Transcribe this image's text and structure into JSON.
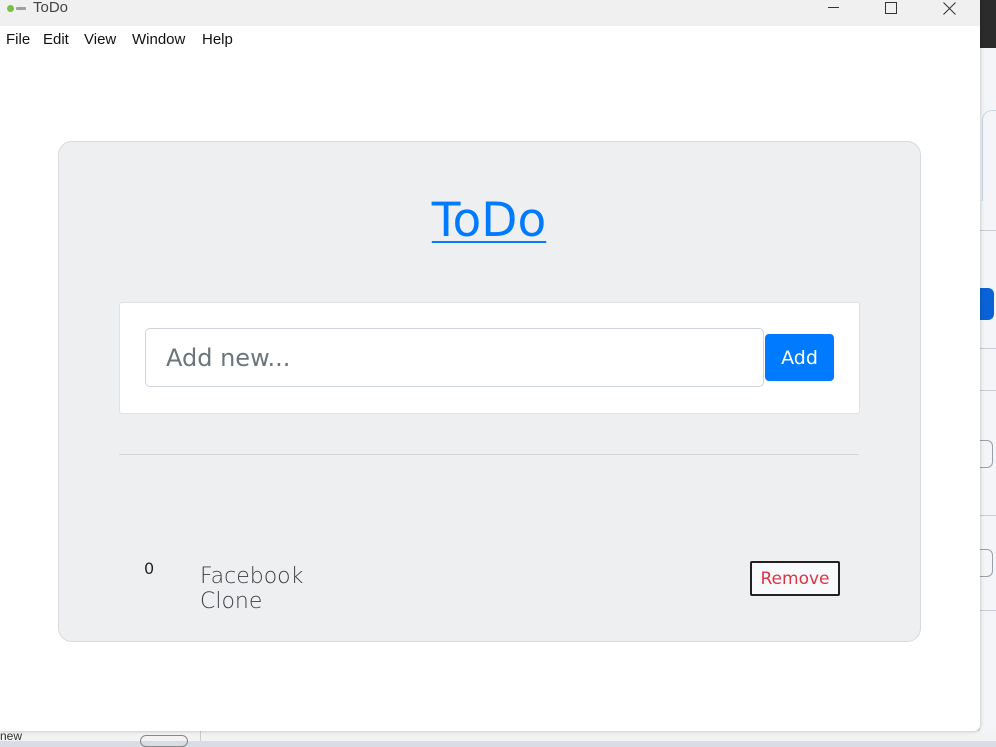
{
  "window": {
    "title": "ToDo",
    "icon": "app-logo-icon",
    "controls": {
      "minimize": "minimize-icon",
      "maximize": "maximize-icon",
      "close": "close-icon"
    }
  },
  "menu": {
    "items": [
      {
        "label": "File"
      },
      {
        "label": "Edit"
      },
      {
        "label": "View"
      },
      {
        "label": "Window"
      },
      {
        "label": "Help"
      }
    ]
  },
  "app": {
    "heading": "ToDo",
    "input": {
      "placeholder": "Add new...",
      "value": ""
    },
    "add_button": "Add",
    "todos": [
      {
        "index": "0",
        "text": "Facebook Clone",
        "remove_label": "Remove"
      }
    ]
  },
  "background": {
    "partial_text": "new"
  },
  "colors": {
    "primary": "#007bff",
    "danger": "#dc3545",
    "card_bg": "#eeeff1"
  }
}
